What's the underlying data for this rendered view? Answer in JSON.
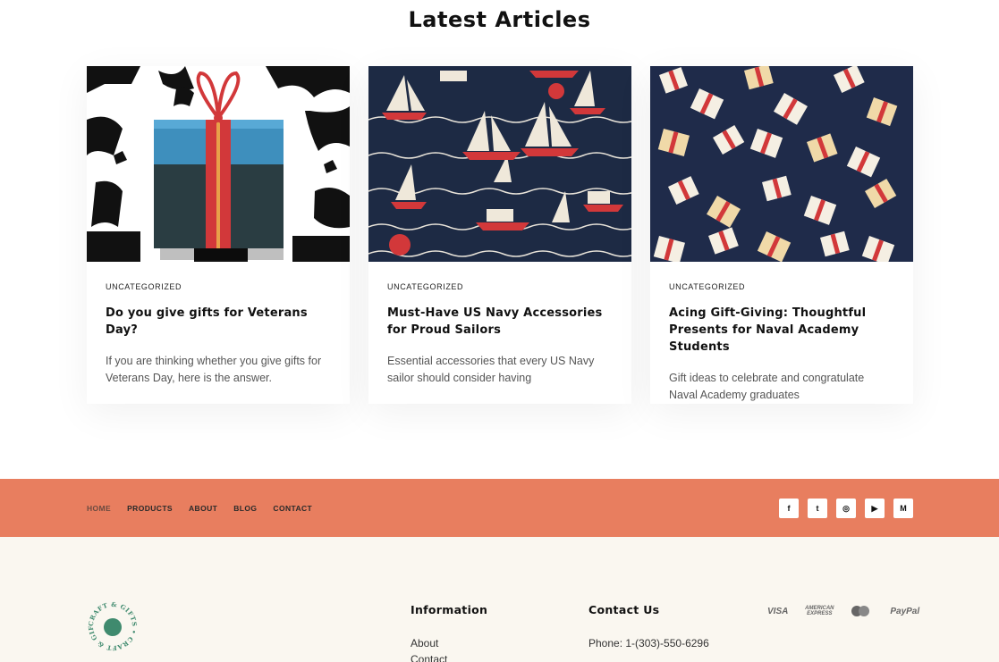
{
  "section": {
    "title": "Latest Articles"
  },
  "articles": [
    {
      "category": "UNCATEGORIZED",
      "title": "Do you give gifts for Veterans Day?",
      "excerpt": "If you are thinking whether you give gifts for Veterans Day, here is the answer."
    },
    {
      "category": "UNCATEGORIZED",
      "title": "Must-Have US Navy Accessories for Proud Sailors",
      "excerpt": "Essential accessories that every US Navy sailor should consider having"
    },
    {
      "category": "UNCATEGORIZED",
      "title": "Acing Gift-Giving: Thoughtful Presents for Naval Academy Students",
      "excerpt": "Gift ideas to celebrate and congratulate Naval Academy graduates"
    }
  ],
  "nav": {
    "items": [
      "HOME",
      "PRODUCTS",
      "ABOUT",
      "BLOG",
      "CONTACT"
    ],
    "active": "HOME"
  },
  "social": {
    "icons": [
      "facebook-icon",
      "twitter-icon",
      "instagram-icon",
      "youtube-icon",
      "medium-icon"
    ],
    "glyphs": [
      "f",
      "t",
      "◎",
      "▶",
      "M"
    ]
  },
  "footer": {
    "logo_text": "CRAFT & GIFTS",
    "information": {
      "title": "Information",
      "links": [
        "About",
        "Contact"
      ]
    },
    "contact": {
      "title": "Contact Us",
      "phone": "Phone: 1-(303)-550-6296"
    },
    "payments": [
      "VISA",
      "AMERICAN EXPRESS",
      "mastercard",
      "PayPal"
    ]
  },
  "colors": {
    "accent": "#e87e5f",
    "footer_bg": "#faf7f0",
    "logo_green": "#3f8a6e"
  }
}
